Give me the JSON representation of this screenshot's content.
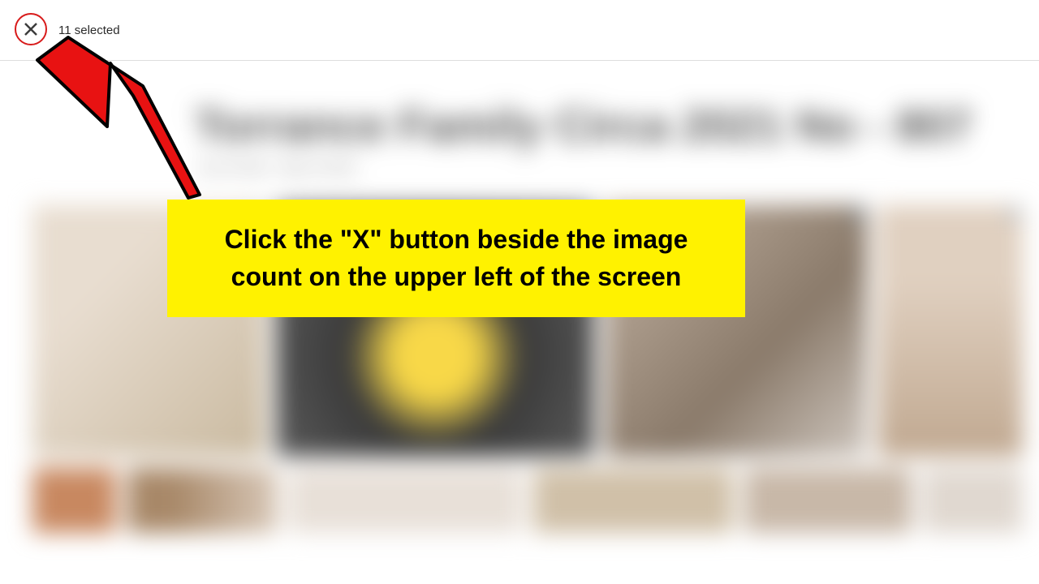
{
  "header": {
    "selected_count_text": "11 selected"
  },
  "instruction": {
    "text": "Click the \"X\" button beside the image count on the upper left of the screen"
  },
  "blurred": {
    "title_placeholder": "Torrance Family Circa 2021 No - 807",
    "date_placeholder": "Jan 25 2021 - May 19 2022"
  }
}
